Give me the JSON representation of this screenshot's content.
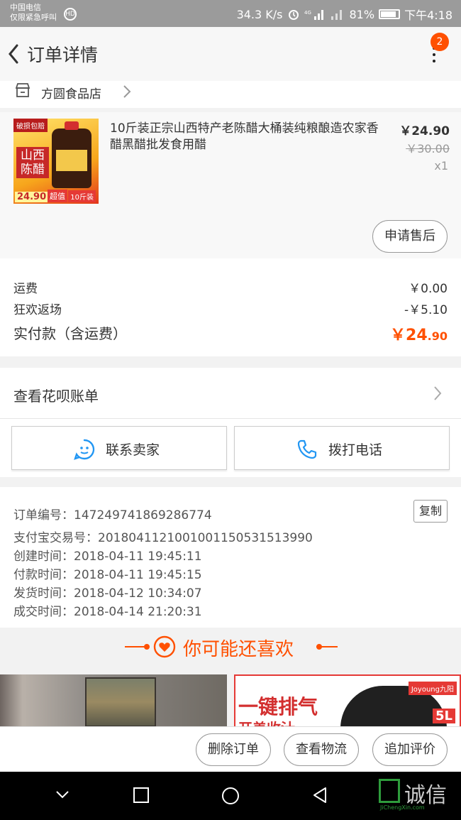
{
  "status_bar": {
    "carrier_line1": "中国电信",
    "carrier_line2": "仅限紧急呼叫",
    "speed": "34.3 K/s",
    "battery": "81%",
    "time": "下午4:18"
  },
  "nav": {
    "title": "订单详情",
    "badge_count": "2"
  },
  "shop": {
    "name": "方圆食品店"
  },
  "product": {
    "title": "10斤装正宗山西特产老陈醋大桶装纯粮酿造农家香醋黑醋批发食用醋",
    "price": "￥24.90",
    "original_price": "￥30.00",
    "quantity": "x1",
    "thumb_tag": "破损包赔",
    "thumb_big_text": "山西陈醋",
    "thumb_price": "24.90",
    "thumb_value": "超值",
    "thumb_weight": "10斤装",
    "after_sales_label": "申请售后"
  },
  "costs": {
    "shipping_label": "运费",
    "shipping_value": "￥0.00",
    "promo_label": "狂欢返场",
    "promo_value": "-￥5.10",
    "total_label": "实付款（含运费）",
    "total_value_main": "￥24",
    "total_value_decimal": ".90"
  },
  "huabei": {
    "label": "查看花呗账单"
  },
  "contact": {
    "seller_label": "联系卖家",
    "phone_label": "拨打电话"
  },
  "order_info": {
    "order_no": "订单编号：147249741869286774",
    "copy_label": "复制",
    "alipay_no": "支付宝交易号：2018041121001001150531513990",
    "created": "创建时间：2018-04-11 19:45:11",
    "paid": "付款时间：2018-04-11 19:45:15",
    "shipped": "发货时间：2018-04-12 10:34:07",
    "completed": "成交时间：2018-04-14 21:20:31"
  },
  "recommend": {
    "title": "你可能还喜欢",
    "right_ad_head": "一键排气",
    "right_ad_sub": "开盖收汁",
    "right_ad_brand": "Joyoung九阳",
    "right_ad_size": "5L"
  },
  "actions": {
    "delete_label": "删除订单",
    "logistics_label": "查看物流",
    "review_label": "追加评价"
  },
  "watermark": {
    "text": "诚信",
    "sub": "JiChengXin.com"
  },
  "colors": {
    "accent": "#ff5000",
    "icon_blue": "#2196f3"
  }
}
